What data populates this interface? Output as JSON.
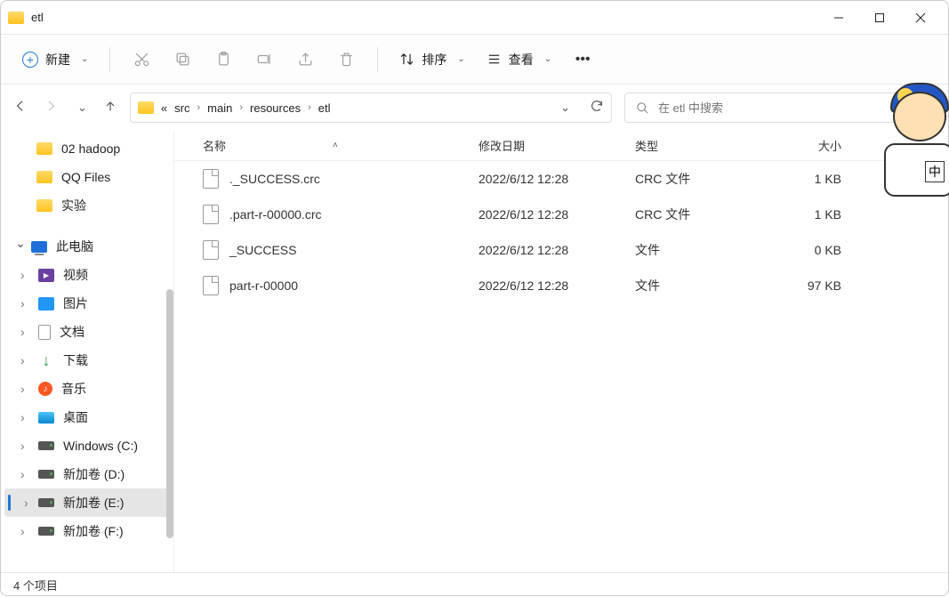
{
  "window": {
    "title": "etl"
  },
  "toolbar": {
    "new_label": "新建",
    "sort_label": "排序",
    "view_label": "查看"
  },
  "breadcrumb": {
    "items": [
      "src",
      "main",
      "resources",
      "etl"
    ],
    "prefix": "«"
  },
  "search": {
    "placeholder": "在 etl 中搜索"
  },
  "sidebar": {
    "quick": [
      {
        "label": "02 hadoop",
        "icon": "folder"
      },
      {
        "label": "QQ Files",
        "icon": "folder"
      },
      {
        "label": "实验",
        "icon": "folder"
      }
    ],
    "pc_label": "此电脑",
    "pc_items": [
      {
        "label": "视频",
        "icon": "video"
      },
      {
        "label": "图片",
        "icon": "pic"
      },
      {
        "label": "文档",
        "icon": "doc"
      },
      {
        "label": "下载",
        "icon": "dl"
      },
      {
        "label": "音乐",
        "icon": "music"
      },
      {
        "label": "桌面",
        "icon": "desk"
      },
      {
        "label": "Windows (C:)",
        "icon": "drive"
      },
      {
        "label": "新加卷 (D:)",
        "icon": "drive"
      },
      {
        "label": "新加卷 (E:)",
        "icon": "drive",
        "selected": true
      },
      {
        "label": "新加卷 (F:)",
        "icon": "drive"
      }
    ]
  },
  "columns": {
    "name": "名称",
    "date": "修改日期",
    "type": "类型",
    "size": "大小"
  },
  "files": [
    {
      "name": "._SUCCESS.crc",
      "date": "2022/6/12 12:28",
      "type": "CRC 文件",
      "size": "1 KB"
    },
    {
      "name": ".part-r-00000.crc",
      "date": "2022/6/12 12:28",
      "type": "CRC 文件",
      "size": "1 KB"
    },
    {
      "name": "_SUCCESS",
      "date": "2022/6/12 12:28",
      "type": "文件",
      "size": "0 KB"
    },
    {
      "name": "part-r-00000",
      "date": "2022/6/12 12:28",
      "type": "文件",
      "size": "97 KB"
    }
  ],
  "status": {
    "item_count": "4 个项目"
  }
}
